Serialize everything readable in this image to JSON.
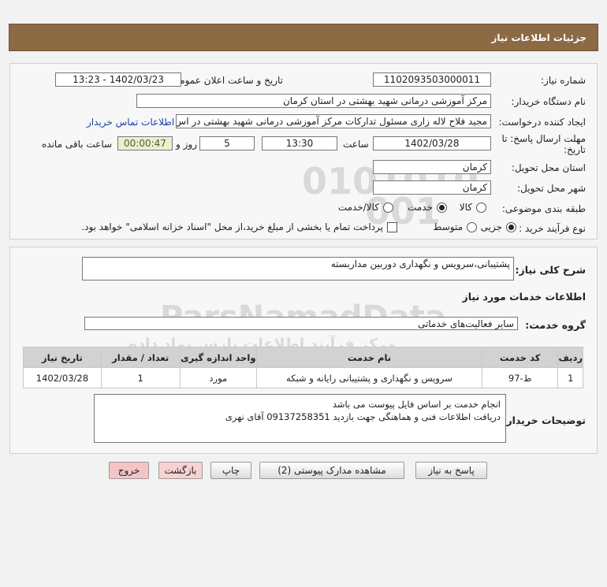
{
  "page_title": "جزئیات اطلاعات نیاز",
  "watermark": {
    "digits_1": "0101010",
    "digits_2": "001",
    "brand": "ParsNamadData",
    "fa_line_1": "مرکز فرآیند اطلاعات پارس نماد داده",
    "fa_line_2": "پایگاه اطلاع رسانی مناقصه و مزایده",
    "phone": "۰۲۱-۸۸۳۴۹۶۷۰"
  },
  "form": {
    "need_number_label": "شماره نیاز:",
    "need_number": "1102093503000011",
    "announce_label": "تاریخ و ساعت اعلان عمومی:",
    "announce_value": "1402/03/23 - 13:23",
    "buyer_org_label": "نام دستگاه خریدار:",
    "buyer_org": "مرکز آموزشی درمانی شهید بهشتی در استان کرمان",
    "requester_label": "ایجاد کننده درخواست:",
    "requester": "مجید فلاح لاله زاری مسئول تدارکات مرکز آموزشی درمانی شهید بهشتی در اس",
    "contact_link": "اطلاعات تماس خریدار",
    "deadline_label_1": "مهلت ارسال پاسخ: تا",
    "deadline_label_2": "تاریخ:",
    "deadline_date": "1402/03/28",
    "time_label": "ساعت",
    "deadline_time": "13:30",
    "days_value": "5",
    "days_label": "روز و",
    "remaining_time": "00:00:47",
    "remaining_label": "ساعت باقی مانده",
    "delivery_province_label": "استان محل تحویل:",
    "delivery_province": "کرمان",
    "delivery_city_label": "شهر محل تحویل:",
    "delivery_city": "کرمان",
    "category_label": "طبقه بندی موضوعی:",
    "category_options": [
      "کالا",
      "خدمت",
      "کالا/خدمت"
    ],
    "process_label": "نوع فرآیند خرید :",
    "process_options": [
      "جزیی",
      "متوسط"
    ],
    "treasury_note": "پرداخت تمام یا بخشی از مبلغ خرید،از محل \"اسناد خزانه اسلامی\" خواهد بود."
  },
  "details": {
    "general_desc_label": "شرح کلی نیاز:",
    "general_desc": "پشتیبانی،سرویس و نگهداری دوربین مداربسته",
    "services_heading": "اطلاعات خدمات مورد نیاز",
    "service_group_label": "گروه خدمت:",
    "service_group": "سایر فعالیت‌های خدماتی",
    "table": {
      "headers": [
        "ردیف",
        "کد خدمت",
        "نام خدمت",
        "واحد اندازه گیری",
        "تعداد / مقدار",
        "تاریخ نیاز"
      ],
      "rows": [
        [
          "1",
          "ط-97",
          "سرویس و نگهداری و پشتیبانی رایانه و شبکه",
          "مورد",
          "1",
          "1402/03/28"
        ]
      ]
    },
    "buyer_desc_label": "توضیحات خریدار:",
    "buyer_desc_line1": "انجام خدمت بر اساس فایل پیوست می باشد",
    "buyer_desc_line2": "دریافت اطلاعات فنی و هماهنگی جهت بازدید 09137258351 آقای نهری"
  },
  "buttons": {
    "reply": "پاسخ به نیاز",
    "attachments": "مشاهده مدارک پیوستی (2)",
    "print": "چاپ",
    "back": "بازگشت",
    "exit": "خروج"
  }
}
